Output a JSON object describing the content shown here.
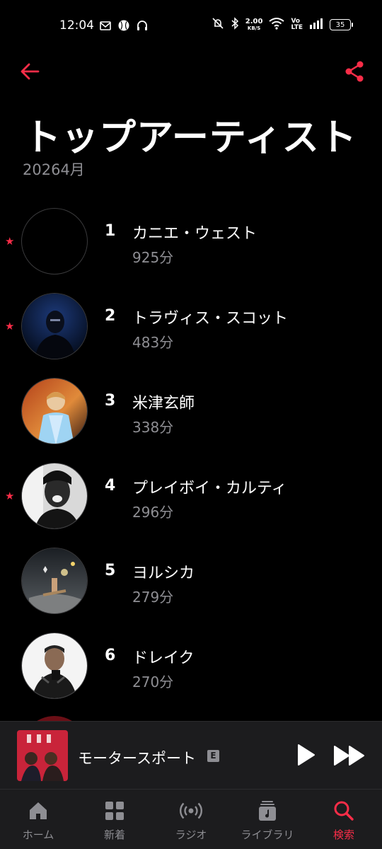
{
  "status_bar": {
    "time": "12:04",
    "net_speed_value": "2.00",
    "net_speed_unit": "KB/S",
    "volte_top": "Vo",
    "volte_bottom": "LTE",
    "battery": "35"
  },
  "header": {
    "title": "トップアーティスト",
    "subtitle": "20264月"
  },
  "artists": [
    {
      "rank": "1",
      "name": "カニエ・ウェスト",
      "minutes": "925分",
      "starred": true
    },
    {
      "rank": "2",
      "name": "トラヴィス・スコット",
      "minutes": "483分",
      "starred": true
    },
    {
      "rank": "3",
      "name": "米津玄師",
      "minutes": "338分",
      "starred": false
    },
    {
      "rank": "4",
      "name": "プレイボイ・カルティ",
      "minutes": "296分",
      "starred": true
    },
    {
      "rank": "5",
      "name": "ヨルシカ",
      "minutes": "279分",
      "starred": false
    },
    {
      "rank": "6",
      "name": "ドレイク",
      "minutes": "270分",
      "starred": false
    }
  ],
  "star_glyph": "★",
  "mini_player": {
    "title": "モータースポート",
    "explicit_badge": "E"
  },
  "tabs": [
    {
      "label": "ホーム",
      "icon": "home-icon"
    },
    {
      "label": "新着",
      "icon": "grid-icon"
    },
    {
      "label": "ラジオ",
      "icon": "radio-icon"
    },
    {
      "label": "ライブラリ",
      "icon": "library-icon"
    },
    {
      "label": "検索",
      "icon": "search-icon"
    }
  ],
  "colors": {
    "accent": "#fa2d48",
    "background": "#000000",
    "secondary_text": "#8e8e93",
    "bar_background": "#1c1c1e"
  }
}
